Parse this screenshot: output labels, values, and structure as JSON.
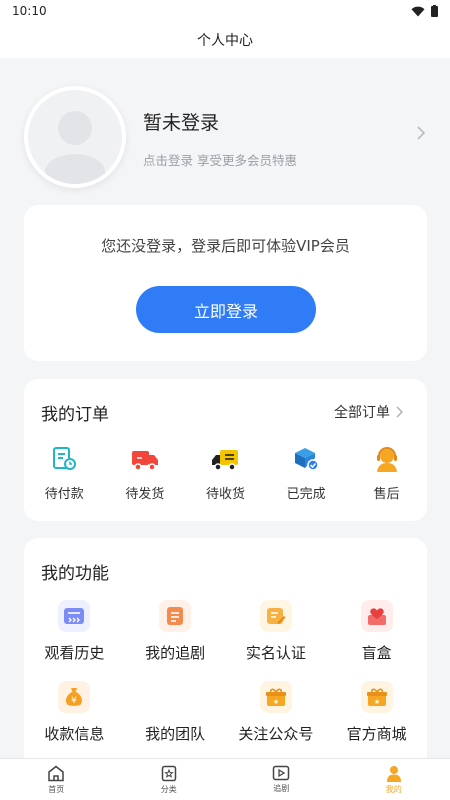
{
  "status_bar": {
    "time": "10:10"
  },
  "nav": {
    "title": "个人中心"
  },
  "profile": {
    "name": "暂未登录",
    "subtitle": "点击登录 享受更多会员特惠"
  },
  "login_card": {
    "tip": "您还没登录，登录后即可体验VIP会员",
    "button": "立即登录"
  },
  "orders": {
    "title": "我的订单",
    "all_label": "全部订单",
    "items": [
      {
        "label": "待付款",
        "icon": "pending-payment-icon"
      },
      {
        "label": "待发货",
        "icon": "truck-icon"
      },
      {
        "label": "待收货",
        "icon": "delivery-truck-icon"
      },
      {
        "label": "已完成",
        "icon": "completed-box-icon"
      },
      {
        "label": "售后",
        "icon": "customer-service-icon"
      }
    ]
  },
  "functions": {
    "title": "我的功能",
    "items": [
      {
        "label": "观看历史",
        "icon": "history-icon"
      },
      {
        "label": "我的追剧",
        "icon": "drama-list-icon"
      },
      {
        "label": "实名认证",
        "icon": "verify-icon"
      },
      {
        "label": "盲盒",
        "icon": "heart-box-icon"
      },
      {
        "label": "收款信息",
        "icon": "money-bag-icon"
      },
      {
        "label": "我的团队",
        "icon": "team-icon"
      },
      {
        "label": "关注公众号",
        "icon": "gift-icon"
      },
      {
        "label": "官方商城",
        "icon": "shop-gift-icon"
      }
    ]
  },
  "tabs": [
    {
      "label": "首页",
      "icon": "home-icon"
    },
    {
      "label": "分类",
      "icon": "category-icon"
    },
    {
      "label": "追剧",
      "icon": "play-icon"
    },
    {
      "label": "我的",
      "icon": "user-icon",
      "active": true
    }
  ],
  "colors": {
    "primary": "#2f7cf6",
    "active_tab": "#f5a623",
    "background": "#f4f5f7"
  }
}
